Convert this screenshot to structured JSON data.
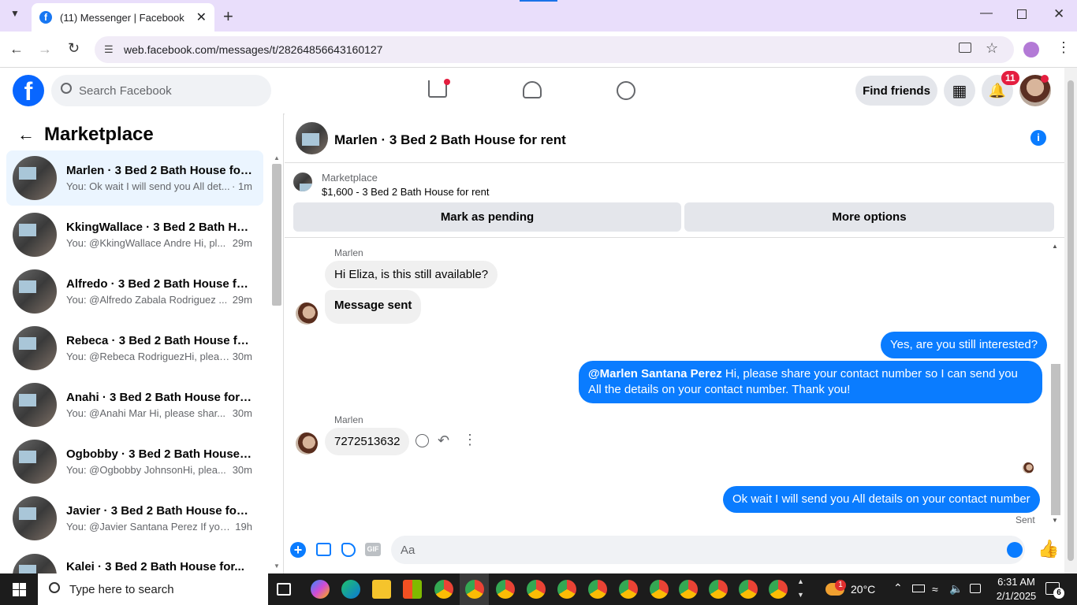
{
  "browser": {
    "tab_title": "(11) Messenger | Facebook",
    "url": "web.facebook.com/messages/t/28264856643160127"
  },
  "fb": {
    "search_placeholder": "Search Facebook",
    "find_friends": "Find friends",
    "notif_count": "11"
  },
  "sidebar": {
    "title": "Marketplace",
    "conversations": [
      {
        "name": "Marlen · 3 Bed 2 Bath House for...",
        "preview": "You: Ok wait I will send you All det...",
        "time": "· 1m"
      },
      {
        "name": "KkingWallace · 3 Bed 2 Bath Ho...",
        "preview": "You: @KkingWallace Andre Hi, pl...",
        "time": "29m"
      },
      {
        "name": "Alfredo · 3 Bed 2 Bath House fo...",
        "preview": "You: @Alfredo Zabala Rodriguez ...",
        "time": "29m"
      },
      {
        "name": "Rebeca · 3 Bed 2 Bath House for...",
        "preview": "You: @Rebeca RodriguezHi, pleas...",
        "time": "30m"
      },
      {
        "name": "Anahi · 3 Bed 2 Bath House for r...",
        "preview": "You: @Anahi Mar Hi, please shar...",
        "time": "30m"
      },
      {
        "name": "Ogbobby · 3 Bed 2 Bath House f...",
        "preview": "You: @Ogbobby JohnsonHi, plea...",
        "time": "30m"
      },
      {
        "name": "Javier · 3 Bed 2 Bath House for r...",
        "preview": "You: @Javier Santana Perez If you ...",
        "time": "19h"
      },
      {
        "name": "Kalei · 3 Bed 2 Bath House for...",
        "preview": "",
        "time": ""
      }
    ]
  },
  "chat": {
    "title": "Marlen · 3 Bed 2 Bath House for rent",
    "listing_label": "Marketplace",
    "listing_title": "$1,600 - 3 Bed 2 Bath House for rent",
    "mark_pending": "Mark as pending",
    "more_options": "More options",
    "sender": "Marlen",
    "msg1": "Hi Eliza, is this still available?",
    "msg2": "Message sent",
    "out1": "Yes, are you still interested?",
    "out2_mention": "@Marlen Santana Perez",
    "out2_text": " Hi, please share your contact number so I can send you All the details on your contact number. Thank you!",
    "msg3": "7272513632",
    "out3": "Ok wait I will send you All details on your contact number",
    "sent_label": "Sent",
    "composer_placeholder": "Aa"
  },
  "taskbar": {
    "search_placeholder": "Type here to search",
    "weather": "20°C",
    "time": "6:31 AM",
    "date": "2/1/2025",
    "notif": "6",
    "weather_badge": "1"
  }
}
